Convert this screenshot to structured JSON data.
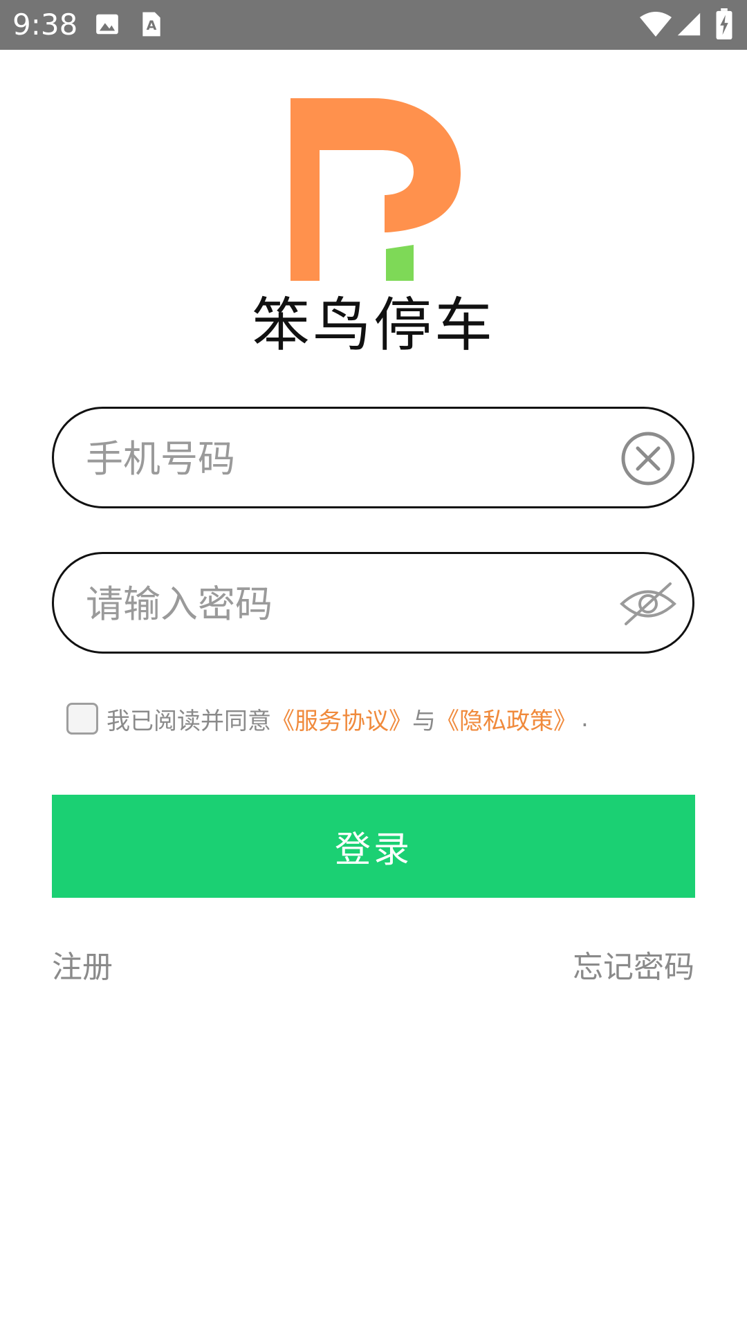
{
  "status_bar": {
    "time": "9:38",
    "icons": [
      "image-icon",
      "text-a-icon",
      "wifi-icon",
      "signal-icon",
      "battery-charging-icon"
    ]
  },
  "app": {
    "name": "笨鸟停车",
    "logo_colors": {
      "orange": "#ff914d",
      "green": "#7ed957"
    }
  },
  "phone_field": {
    "placeholder": "手机号码",
    "value": "",
    "clear_icon": "clear-circle-icon"
  },
  "password_field": {
    "placeholder": "请输入密码",
    "value": "",
    "visibility_icon": "eye-off-icon"
  },
  "agreement": {
    "checked": false,
    "prefix": "我已阅读并同意",
    "service_link": "《服务协议》",
    "connector": "与",
    "privacy_link": "《隐私政策》",
    "suffix": "."
  },
  "login_button": {
    "label": "登录",
    "color": "#1bd073"
  },
  "links": {
    "register": "注册",
    "forgot_password": "忘记密码"
  },
  "colors": {
    "status_bar": "#757575",
    "accent_link": "#f08a3c",
    "muted_text": "#8a8a8a"
  }
}
